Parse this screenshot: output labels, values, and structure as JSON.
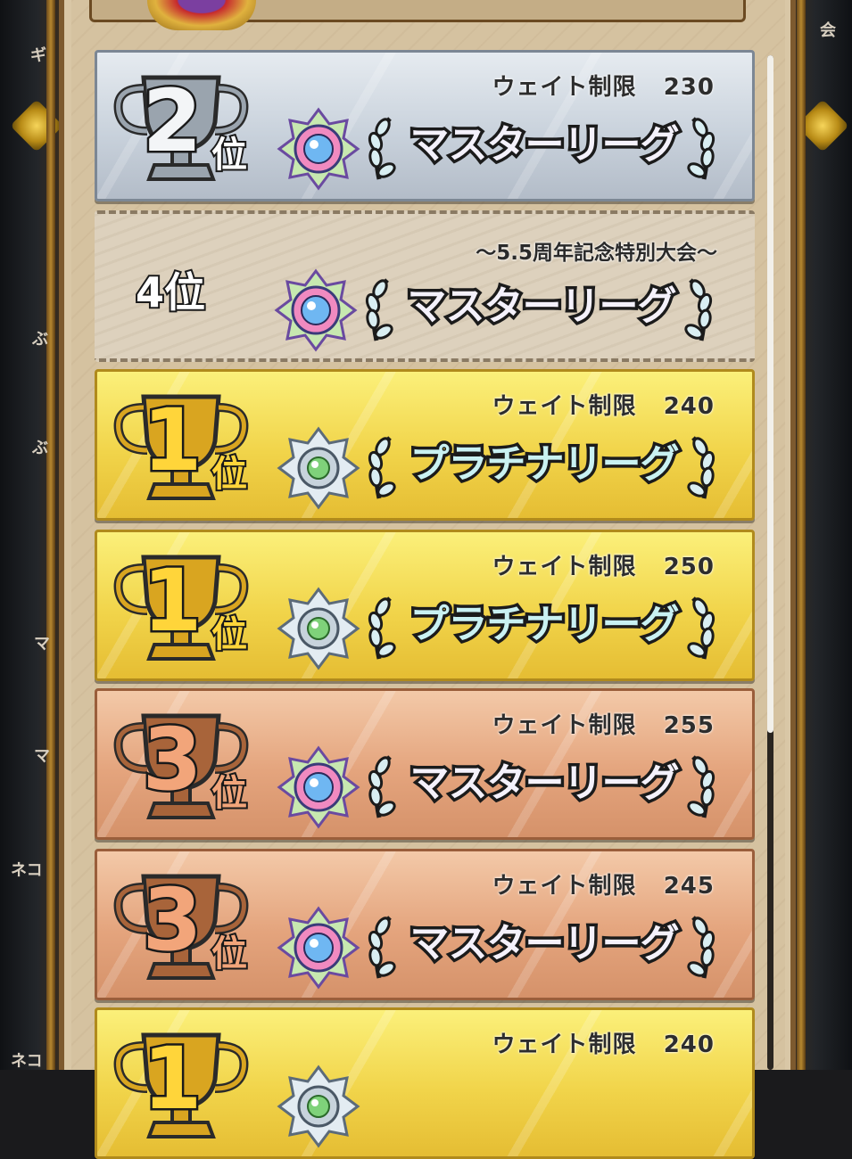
{
  "side_left_glyphs": [
    "ギ",
    "ぶ",
    "ぶ",
    "マ",
    "マ",
    "ネコ",
    "ネコ"
  ],
  "side_right_glyphs": [
    "会"
  ],
  "cards": [
    {
      "style": "silver",
      "rank": "2",
      "rank_suffix": "位",
      "weight_label": "ウェイト制限",
      "weight_value": "230",
      "league": "マスターリーグ",
      "league_type": "master",
      "trophy_color": "#9aa4ae"
    },
    {
      "style": "plain",
      "rank_text": "4位",
      "subtitle": "～5.5周年記念特別大会～",
      "league": "マスターリーグ",
      "league_type": "master"
    },
    {
      "style": "gold",
      "rank": "1",
      "rank_suffix": "位",
      "weight_label": "ウェイト制限",
      "weight_value": "240",
      "league": "プラチナリーグ",
      "league_type": "platinum",
      "trophy_color": "#d9a520"
    },
    {
      "style": "gold",
      "rank": "1",
      "rank_suffix": "位",
      "weight_label": "ウェイト制限",
      "weight_value": "250",
      "league": "プラチナリーグ",
      "league_type": "platinum",
      "trophy_color": "#d9a520"
    },
    {
      "style": "bronze",
      "rank": "3",
      "rank_suffix": "位",
      "weight_label": "ウェイト制限",
      "weight_value": "255",
      "league": "マスターリーグ",
      "league_type": "master",
      "trophy_color": "#a8643a"
    },
    {
      "style": "bronze",
      "rank": "3",
      "rank_suffix": "位",
      "weight_label": "ウェイト制限",
      "weight_value": "245",
      "league": "マスターリーグ",
      "league_type": "master",
      "trophy_color": "#a8643a"
    },
    {
      "style": "gold",
      "rank": "1",
      "rank_suffix": "位",
      "weight_label": "ウェイト制限",
      "weight_value": "240",
      "league": "",
      "league_type": "platinum",
      "trophy_color": "#d9a520"
    }
  ],
  "icons": {
    "master_emblem": "master-league-emblem-icon",
    "platinum_emblem": "platinum-league-emblem-icon",
    "trophy": "trophy-icon",
    "laurel": "laurel-icon"
  }
}
